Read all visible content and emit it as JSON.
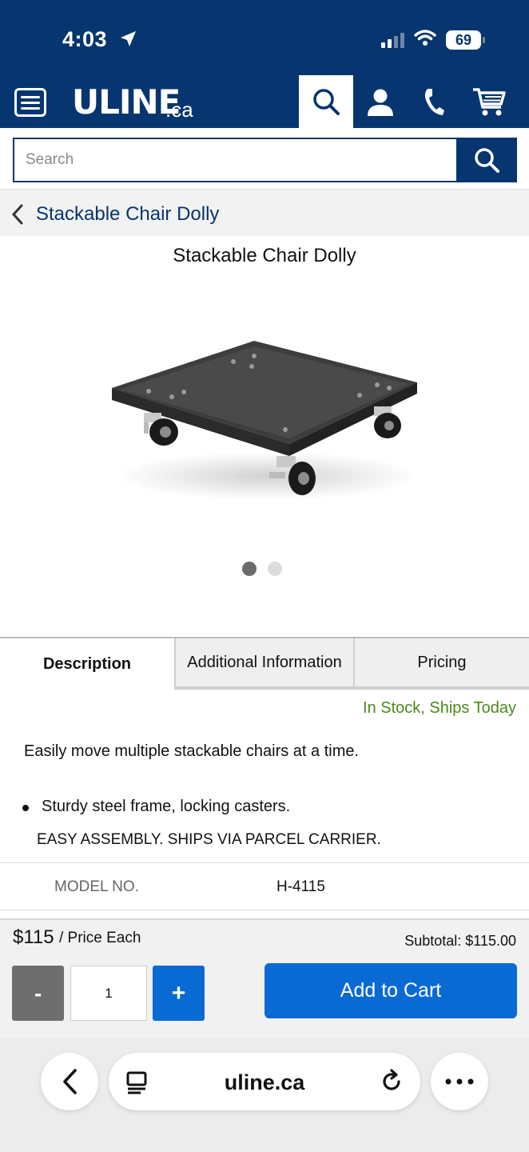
{
  "status_bar": {
    "time": "4:03",
    "battery": "69"
  },
  "header": {
    "logo": "ULINE",
    "logo_suffix": ".ca"
  },
  "search": {
    "placeholder": "Search"
  },
  "breadcrumb": {
    "label": "Stackable Chair Dolly"
  },
  "product": {
    "title": "Stackable Chair Dolly",
    "image_count": 2,
    "active_image": 1
  },
  "tabs": [
    {
      "label": "Description",
      "active": true
    },
    {
      "label": "Additional Information",
      "active": false
    },
    {
      "label": "Pricing",
      "active": false
    }
  ],
  "stock_status": "In Stock, Ships Today",
  "description": {
    "text": "Easily move multiple stackable chairs at a time.",
    "bullets": [
      "Sturdy steel frame, locking casters."
    ],
    "note": "EASY ASSEMBLY. SHIPS VIA PARCEL CARRIER."
  },
  "specs": [
    {
      "label": "MODEL NO.",
      "value": "H-4115"
    }
  ],
  "purchase": {
    "price": "$115",
    "price_unit": "/ Price Each",
    "subtotal": "Subtotal: $115.00",
    "quantity": "1",
    "minus_label": "-",
    "plus_label": "+",
    "add_to_cart_label": "Add to Cart"
  },
  "browser": {
    "url": "uline.ca"
  },
  "colors": {
    "brand_navy": "#06356f",
    "action_blue": "#0a6ad4",
    "stock_green": "#4a8a1c",
    "minus_gray": "#6e6e6e"
  },
  "icons": [
    "location-arrow-icon",
    "signal-icon",
    "wifi-icon",
    "battery-icon",
    "menu-icon",
    "search-icon",
    "account-icon",
    "phone-icon",
    "cart-icon",
    "chevron-left-icon",
    "tabs-icon",
    "reload-icon",
    "more-icon"
  ]
}
